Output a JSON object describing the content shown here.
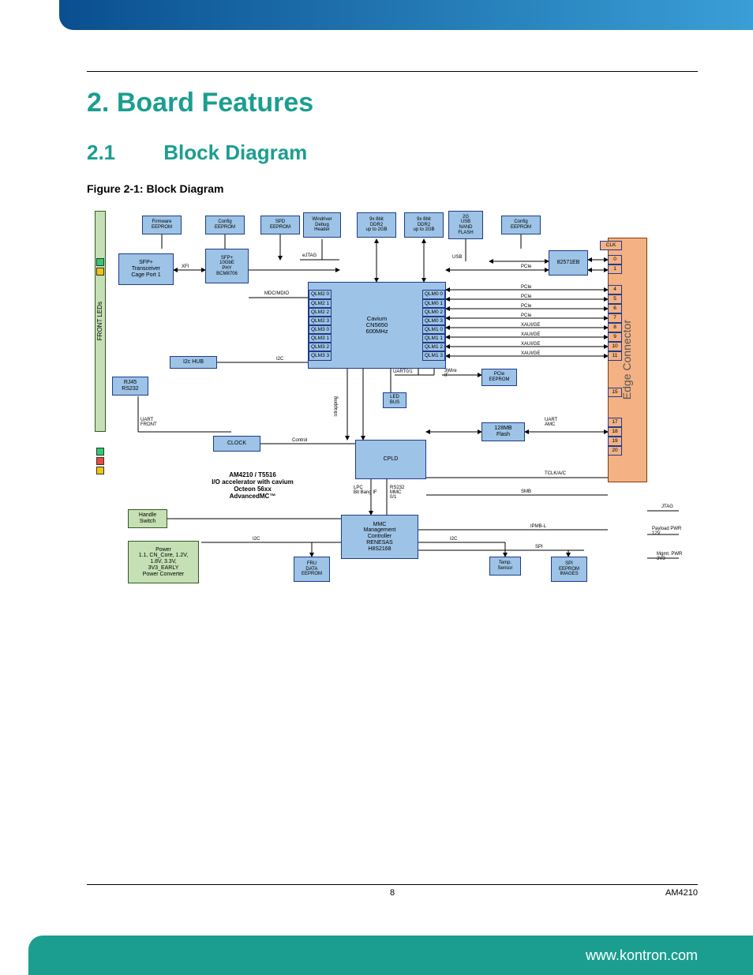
{
  "chapter": {
    "num": "2.",
    "title": "Board Features"
  },
  "section": {
    "num": "2.1",
    "title": "Block Diagram"
  },
  "figure_caption": "Figure 2-1: Block Diagram",
  "footer": {
    "page": "8",
    "doc": "AM4210",
    "url": "www.kontron.com"
  },
  "diagram": {
    "top_row": {
      "fw_eeprom": "Firmware\nEEPROM",
      "cfg_eeprom_l": "Config\nEEPROM",
      "spd_eeprom": "SPD\nEEPROM",
      "wr_debug": "Windriver\nDebug\nHeader",
      "ddr2_l": "9x 8bit\nDDR2\nup to 2GB",
      "ddr2_r": "9x 8bit\nDDR2\nup to 2GB",
      "nand": "2G\nUSB\nNAND\nFLASH",
      "cfg_eeprom_r": "Config\nEEPROM"
    },
    "sfp": {
      "cage": "SFP+\nTransceiver\nCage Port 1",
      "phy": "SFP+\n10GbE\nPHY\nBCM8706"
    },
    "chip": "82571EB",
    "cpu": {
      "name": "Cavium\nCN5650\n600MHz",
      "qlm_left": [
        "QLM2 0",
        "QLM2 1",
        "QLM2 2",
        "QLM2 3",
        "QLM3 0",
        "QLM3 1",
        "QLM3 2",
        "QLM3 3"
      ],
      "qlm_right": [
        "QLM0 0",
        "QLM0 1",
        "QLM0 2",
        "QLM0 3",
        "QLM1 0",
        "QLM1 1",
        "QLM1 2",
        "QLM1 3"
      ]
    },
    "i2c_hub": "I2c HUB",
    "rj45": "RJ45\nRS232",
    "clock": "CLOCK",
    "pcie_eeprom": "PCIe\nEEPROM",
    "led_bus": "LED\nBUS",
    "front_leds_label": "FRONT LEDs",
    "uart_front": "UART\nFRONT",
    "flash128": "128MB\nFlash",
    "cpld": "CPLD",
    "handle": "Handle\nSwitch",
    "power": "Power\n1.1, CN_Core, 1.2V,\n1.8V, 3.3V,\n3V3_EARLY\nPower Converter",
    "fru": "FRU\nDATA\nEEPROM",
    "mmc": "MMC\nManagement\nController\nRENESAS\nH8S2168",
    "temp": "Temp.\nSensor",
    "spi": "SPI\nEEPROM\nIMAGES",
    "edge_label": "Edge Connector",
    "edge_pins": {
      "clk": "CLK",
      "group0": [
        "0",
        "1"
      ],
      "group1": [
        "4",
        "5",
        "6",
        "7",
        "8",
        "9",
        "10",
        "11"
      ],
      "group2": [
        "15"
      ],
      "group3": [
        "17",
        "18",
        "19",
        "20"
      ]
    },
    "bus_labels": {
      "xfi": "XFI",
      "ejtag": "eJTAG",
      "usb": "USB",
      "pcie": "PCIe",
      "mdcmdio": "MDC/MDIO",
      "i2c": "I2C",
      "uart01": "UART0/1",
      "3wire": "3Wire\nIF",
      "strapping": "Strapping",
      "control": "Control",
      "lpc": "LPC\nBit Bang IF",
      "rs232": "RS232\nMMC\n0/1",
      "uart_amc": "UART\nAMC",
      "smb": "SMB",
      "ipmb": "IPMB-L",
      "spi": "SPI",
      "jtag": "JTAG",
      "payload": "Payload PWR\n12V",
      "mgmt": "Mgmt. PWR\n3V3",
      "tclk": "TCLK/A/C",
      "pcie_lanes": [
        "PCIe",
        "PCIe",
        "PCIe",
        "PCIe",
        "XAUI/GE",
        "XAUI/GE",
        "XAUI/GE",
        "XAUI/GE"
      ]
    },
    "title_block": "AM4210 / T5516\nI/O accelerator with cavium\nOcteon 56xx\nAdvancedMC™"
  }
}
